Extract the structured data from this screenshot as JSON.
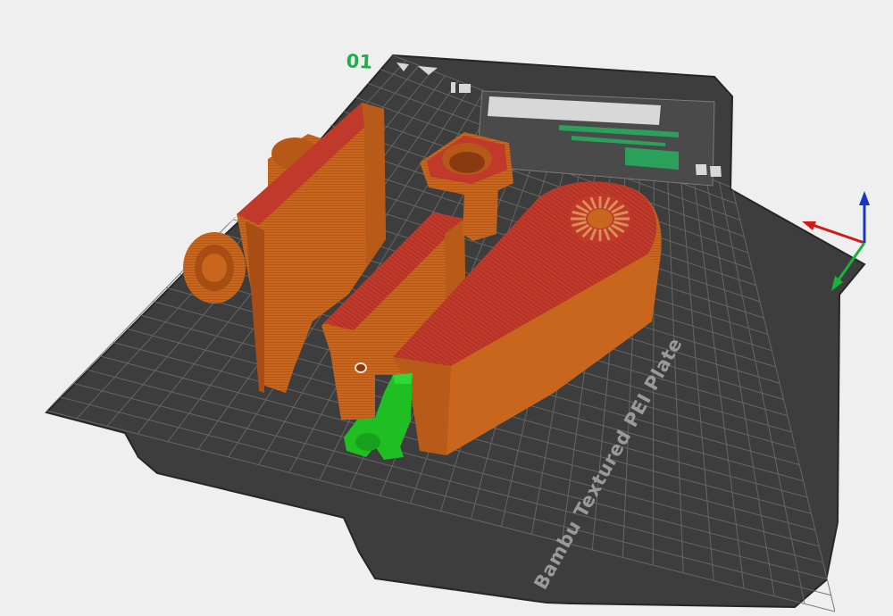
{
  "viewport": {
    "plate_number": "01",
    "plate_name": "Bambu Textured PEI Plate"
  },
  "colors": {
    "background": "#efeff0",
    "plate": "#3d3d3d",
    "grid": "#6a6a6a",
    "model_wall": "#c8661d",
    "model_top": "#c0392b",
    "support": "#1fbf23",
    "axis_x": "#d11a1a",
    "axis_y": "#19b23a",
    "axis_z": "#1636c8",
    "plate_number": "#1fae4c"
  }
}
